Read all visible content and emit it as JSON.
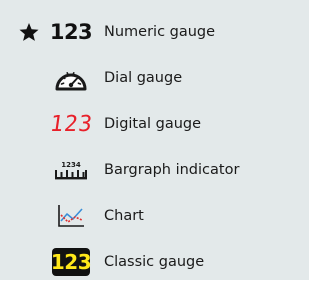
{
  "menu": {
    "items": [
      {
        "label": "Numeric gauge",
        "icon": "numeric-123-icon",
        "icon_text": "123",
        "checked": true
      },
      {
        "label": "Dial gauge",
        "icon": "dial-gauge-icon",
        "checked": false
      },
      {
        "label": "Digital gauge",
        "icon": "digital-123-icon",
        "icon_text": "123",
        "checked": false
      },
      {
        "label": "Bargraph indicator",
        "icon": "bargraph-icon",
        "icon_text": "1234",
        "checked": false
      },
      {
        "label": "Chart",
        "icon": "chart-icon",
        "checked": false
      },
      {
        "label": "Classic gauge",
        "icon": "classic-123-icon",
        "icon_text": "123",
        "checked": false
      }
    ]
  },
  "colors": {
    "menu_background": "#e3e9ea",
    "digital_red": "#e8202a",
    "classic_yellow": "#ffe81a",
    "chart_blue": "#3a8fd9",
    "chart_red": "#e03030"
  }
}
